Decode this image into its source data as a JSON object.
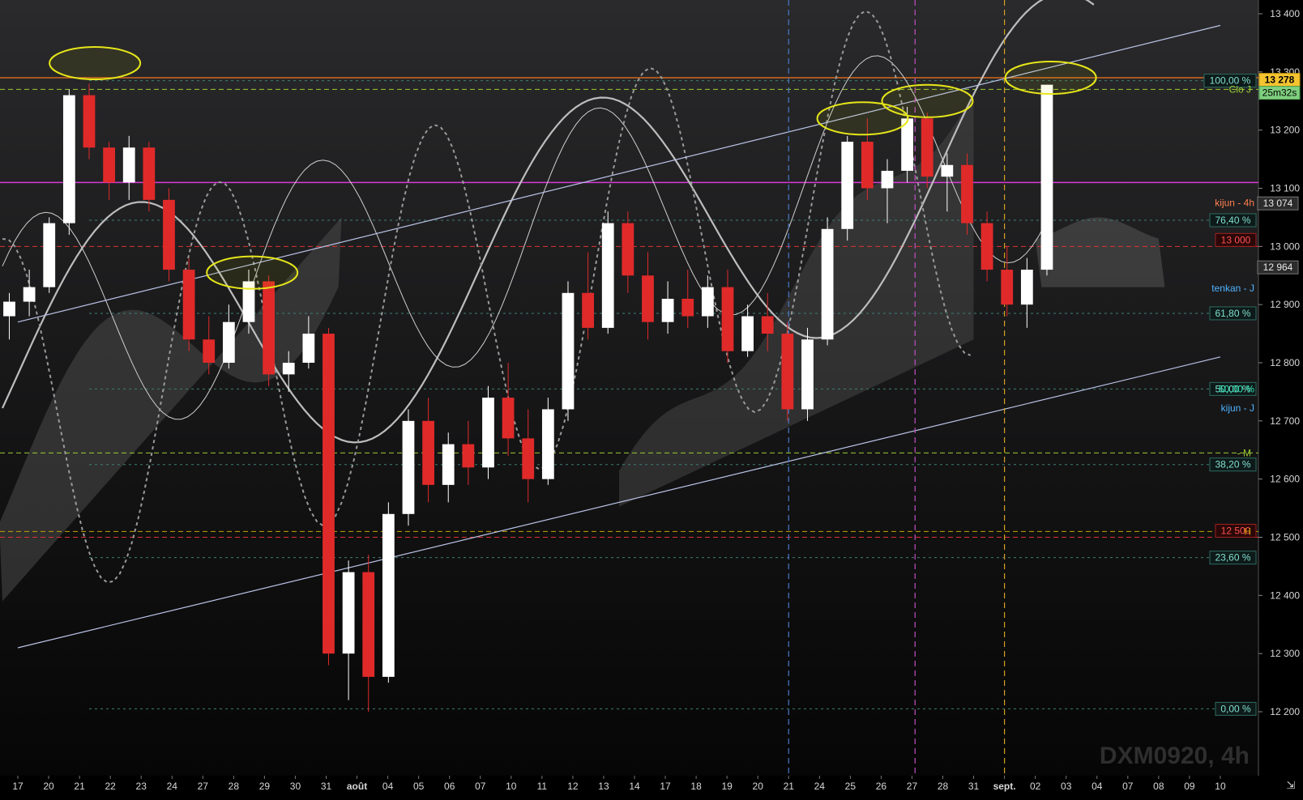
{
  "chart_data": {
    "type": "candlestick",
    "symbol_watermark": "DXM0920, 4h",
    "timeframe": "4h",
    "ylim": [
      12130,
      13420
    ],
    "y_ticks": [
      12200,
      12300,
      12400,
      12500,
      12600,
      12700,
      12800,
      12900,
      13000,
      13100,
      13200,
      13300,
      13400
    ],
    "y_tick_labels": [
      "12 200",
      "12 300",
      "12 400",
      "12 500",
      "12 600",
      "12 700",
      "12 800",
      "12 900",
      "13 000",
      "13 100",
      "13 200",
      "13 300",
      "13 400"
    ],
    "x_tick_labels": [
      "17",
      "20",
      "21",
      "22",
      "23",
      "24",
      "27",
      "28",
      "29",
      "30",
      "31",
      "août",
      "04",
      "05",
      "06",
      "07",
      "10",
      "11",
      "12",
      "13",
      "14",
      "17",
      "18",
      "19",
      "20",
      "21",
      "24",
      "25",
      "26",
      "27",
      "28",
      "31",
      "sept.",
      "02",
      "03",
      "04",
      "07",
      "08",
      "09",
      "10"
    ],
    "current_price": {
      "label": "13 278",
      "value": 13278,
      "countdown": "25m32s"
    },
    "price_lines": [
      {
        "name": "resistance-high",
        "value": 13290,
        "color": "#d2691e",
        "style": "solid"
      },
      {
        "name": "clo-j",
        "value": 13270,
        "label": "Clo J",
        "color": "#9acd32",
        "style": "dashed"
      },
      {
        "name": "magenta-level",
        "value": 13110,
        "color": "#d63bd6",
        "style": "solid"
      },
      {
        "name": "round-13000",
        "value": 13000,
        "label": "13 000",
        "color": "#e03030",
        "style": "dashed"
      },
      {
        "name": "round-12500",
        "value": 12500,
        "label": "12 500",
        "color": "#e03030",
        "style": "dashed"
      },
      {
        "name": "level-m",
        "value": 12645,
        "label": "- M",
        "color": "#9acd32",
        "style": "dashed"
      },
      {
        "name": "level-h",
        "value": 12510,
        "label": "H",
        "color": "#c8a000",
        "style": "dashed"
      }
    ],
    "fibonacci": [
      {
        "label": "100,00 %",
        "value": 13285
      },
      {
        "label": "76,40 %",
        "value": 13045
      },
      {
        "label": "61,80 %",
        "value": 12885
      },
      {
        "label": "50,00 %",
        "value": 12755
      },
      {
        "label": "38,20 %",
        "value": 12625
      },
      {
        "label": "23,60 %",
        "value": 12465
      },
      {
        "label": "0,00 %",
        "value": 12205
      }
    ],
    "indicator_labels": [
      {
        "label": "kijun - 4h",
        "value": 13075,
        "color": "#ff7f50"
      },
      {
        "label": "tenkan - J",
        "value": 12928,
        "color": "#4fb3ff"
      },
      {
        "label": "kijun - J",
        "value": 12722,
        "color": "#4fb3ff"
      },
      {
        "label": "50,00 %",
        "value": 12755,
        "color": "#2ee6b4"
      }
    ],
    "side_values": [
      {
        "label": "13 074",
        "value": 13074
      },
      {
        "label": "12 964",
        "value": 12964
      }
    ],
    "channel": {
      "upper": {
        "from": {
          "x": 0,
          "y": 12870
        },
        "to": {
          "x": 39,
          "y": 13380
        }
      },
      "lower": {
        "from": {
          "x": 0,
          "y": 12310
        },
        "to": {
          "x": 39,
          "y": 12810
        }
      }
    },
    "vertical_markers": [
      {
        "name": "marker-blue",
        "x": 25.0,
        "color": "#4a78c8"
      },
      {
        "name": "marker-magenta",
        "x": 29.1,
        "color": "#c050c0"
      },
      {
        "name": "marker-orange",
        "x": 32.0,
        "color": "#d4a020"
      }
    ],
    "highlight_ellipses": [
      {
        "x": 2.5,
        "y": 13315
      },
      {
        "x": 7.6,
        "y": 12955
      },
      {
        "x": 27.4,
        "y": 13220
      },
      {
        "x": 29.5,
        "y": 13250
      },
      {
        "x": 33.5,
        "y": 13290
      }
    ],
    "candles_ohlc_seed": [
      [
        12880,
        12920,
        12840,
        12905
      ],
      [
        12905,
        12960,
        12880,
        12930
      ],
      [
        12930,
        13050,
        12920,
        13040
      ],
      [
        13040,
        13270,
        13020,
        13260
      ],
      [
        13260,
        13280,
        13150,
        13170
      ],
      [
        13170,
        13180,
        13080,
        13110
      ],
      [
        13110,
        13190,
        13080,
        13170
      ],
      [
        13170,
        13180,
        13060,
        13080
      ],
      [
        13080,
        13100,
        12940,
        12960
      ],
      [
        12960,
        12980,
        12820,
        12840
      ],
      [
        12840,
        12880,
        12780,
        12800
      ],
      [
        12800,
        12900,
        12790,
        12870
      ],
      [
        12870,
        12960,
        12850,
        12940
      ],
      [
        12940,
        12950,
        12760,
        12780
      ],
      [
        12780,
        12820,
        12750,
        12800
      ],
      [
        12800,
        12880,
        12790,
        12850
      ],
      [
        12850,
        12860,
        12280,
        12300
      ],
      [
        12300,
        12460,
        12220,
        12440
      ],
      [
        12440,
        12470,
        12200,
        12260
      ],
      [
        12260,
        12560,
        12250,
        12540
      ],
      [
        12540,
        12720,
        12520,
        12700
      ],
      [
        12700,
        12740,
        12560,
        12590
      ],
      [
        12590,
        12680,
        12560,
        12660
      ],
      [
        12660,
        12700,
        12590,
        12620
      ],
      [
        12620,
        12760,
        12600,
        12740
      ],
      [
        12740,
        12800,
        12640,
        12670
      ],
      [
        12670,
        12720,
        12560,
        12600
      ],
      [
        12600,
        12740,
        12590,
        12720
      ],
      [
        12720,
        12940,
        12700,
        12920
      ],
      [
        12920,
        12990,
        12840,
        12860
      ],
      [
        12860,
        13060,
        12850,
        13040
      ],
      [
        13040,
        13060,
        12920,
        12950
      ],
      [
        12950,
        12990,
        12840,
        12870
      ],
      [
        12870,
        12940,
        12850,
        12910
      ],
      [
        12910,
        12960,
        12860,
        12880
      ],
      [
        12880,
        12950,
        12860,
        12930
      ],
      [
        12930,
        12960,
        12800,
        12820
      ],
      [
        12820,
        12900,
        12810,
        12880
      ],
      [
        12880,
        12920,
        12820,
        12850
      ],
      [
        12850,
        12870,
        12700,
        12720
      ],
      [
        12720,
        12860,
        12700,
        12840
      ],
      [
        12840,
        13050,
        12830,
        13030
      ],
      [
        13030,
        13190,
        13010,
        13180
      ],
      [
        13180,
        13220,
        13080,
        13100
      ],
      [
        13100,
        13150,
        13040,
        13130
      ],
      [
        13130,
        13240,
        13110,
        13220
      ],
      [
        13220,
        13230,
        13100,
        13120
      ],
      [
        13120,
        13160,
        13060,
        13140
      ],
      [
        13140,
        13160,
        13020,
        13040
      ],
      [
        13040,
        13060,
        12940,
        12960
      ],
      [
        12960,
        13000,
        12880,
        12900
      ],
      [
        12900,
        12980,
        12860,
        12960
      ],
      [
        12960,
        13278,
        12950,
        13278
      ]
    ]
  }
}
